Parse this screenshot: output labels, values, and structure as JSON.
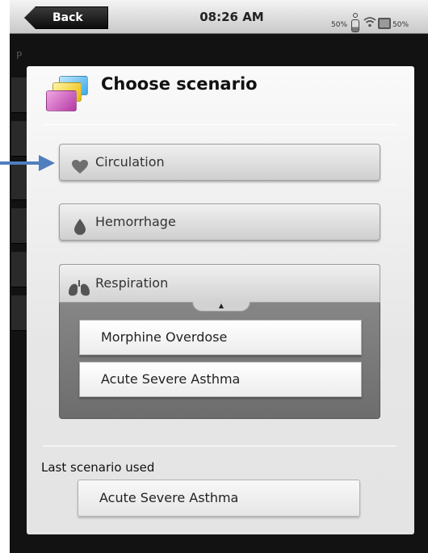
{
  "status_bar": {
    "back_label": "Back",
    "time": "08:26 AM",
    "battery_left": "50%",
    "battery_right": "50%"
  },
  "background": {
    "partial_text": "P"
  },
  "modal": {
    "title": "Choose scenario",
    "icon": "scenario-cards-icon",
    "options": [
      {
        "label": "Circulation",
        "icon": "heart-icon"
      },
      {
        "label": "Hemorrhage",
        "icon": "blood-drop-icon"
      },
      {
        "label": "Respiration",
        "icon": "lungs-icon",
        "expanded": true,
        "children": [
          "Morphine Overdose",
          "Acute Severe Asthma"
        ]
      }
    ],
    "last_used_label": "Last scenario used",
    "last_used_value": "Acute Severe Asthma"
  },
  "colors": {
    "pointer_arrow": "#4f7fbf",
    "expanded_panel": "#7d7d7d"
  }
}
